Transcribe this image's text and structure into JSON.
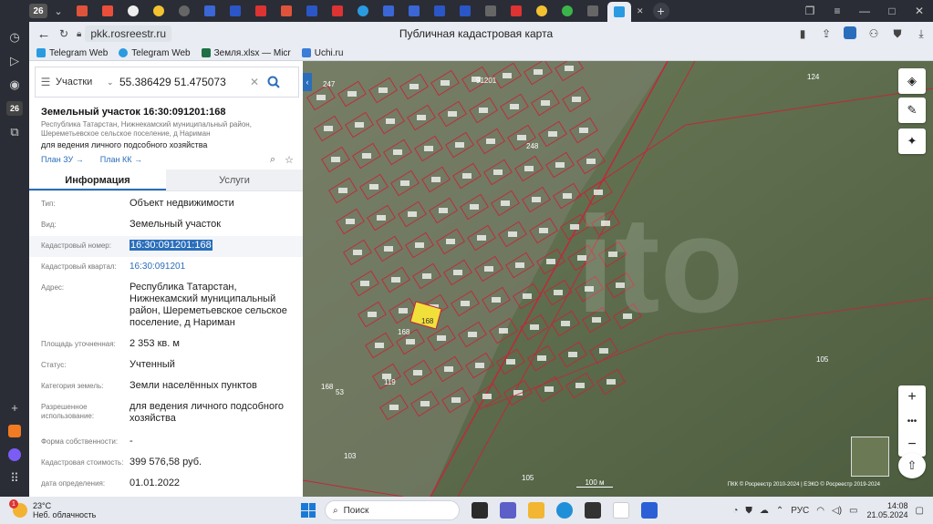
{
  "browser": {
    "tab_counter": "26",
    "url": "pkk.rosreestr.ru",
    "page_title": "Публичная кадастровая карта",
    "rail_badge": "26",
    "bookmarks": [
      {
        "label": "Telegram Web",
        "color": "#2a9be0"
      },
      {
        "label": "Telegram Web",
        "color": "#2a9be0"
      },
      {
        "label": "Земля.xlsx — Micr",
        "color": "#1e7145"
      },
      {
        "label": "Uchi.ru",
        "color": "#3b7dd8"
      }
    ]
  },
  "search": {
    "layer_select": "Участки",
    "query": "55.386429 51.475073"
  },
  "object": {
    "title": "Земельный участок 16:30:091201:168",
    "address_small": "Республика Татарстан, Нижнекамский муниципальный район, Шереметьевское сельское поселение, д Нариман",
    "purpose": "для ведения личного подсобного хозяйства",
    "plan_zu": "План ЗУ",
    "plan_kk": "План КК"
  },
  "tabs": {
    "info": "Информация",
    "services": "Услуги"
  },
  "rows": [
    {
      "label": "Тип:",
      "value": "Объект недвижимости"
    },
    {
      "label": "Вид:",
      "value": "Земельный участок"
    },
    {
      "label": "Кадастровый номер:",
      "value": "16:30:091201:168"
    },
    {
      "label": "Кадастровый квартал:",
      "value": "16:30:091201"
    },
    {
      "label": "Адрес:",
      "value": "Республика Татарстан, Нижнекамский муниципальный район, Шереметьевское сельское поселение, д Нариман"
    },
    {
      "label": "Площадь уточненная:",
      "value": "2 353 кв. м"
    },
    {
      "label": "Статус:",
      "value": "Учтенный"
    },
    {
      "label": "Категория земель:",
      "value": "Земли населённых пунктов"
    },
    {
      "label": "Разрешенное использование:",
      "value": "для ведения личного подсобного хозяйства"
    },
    {
      "label": "Форма собственности:",
      "value": "-"
    },
    {
      "label": "Кадастровая стоимость:",
      "value": "399 576,58 руб."
    },
    {
      "label": "дата определения:",
      "value": "01.01.2022"
    }
  ],
  "map": {
    "scale_label": "100 м",
    "copyright": "ПКК © Росреестр 2010-2024 | ЕЭКО © Росреестр 2019-2024",
    "labels": [
      "247",
      "124",
      "91201",
      "248",
      "105",
      "119",
      "103",
      "105",
      "53",
      "168",
      "168",
      "168"
    ],
    "watermark": "ito"
  },
  "taskbar": {
    "temp": "23°C",
    "weather_desc": "Неб. облачность",
    "weather_badge": "1",
    "search_label": "Поиск",
    "lang": "РУС",
    "time": "14:08",
    "date": "21.05.2024"
  }
}
